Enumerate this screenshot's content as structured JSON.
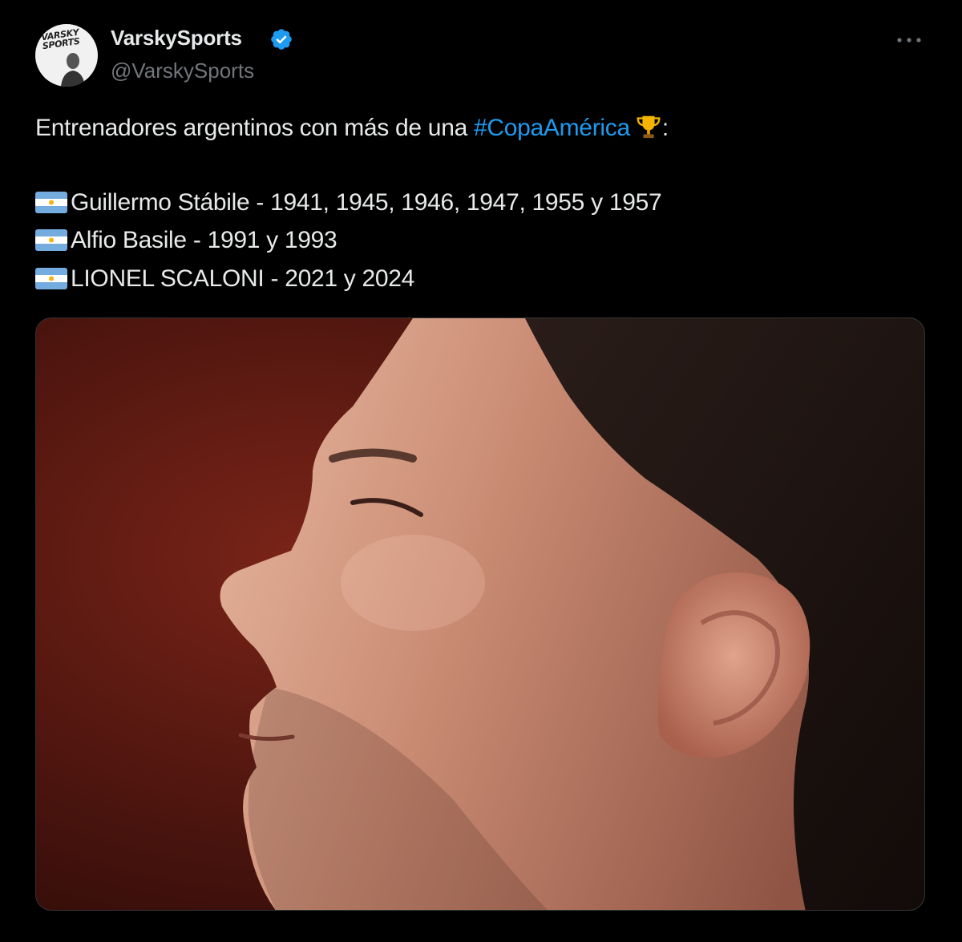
{
  "author": {
    "display_name": "VarskySports",
    "handle": "@VarskySports",
    "verified": true,
    "avatar_logo_text": "VARSKY SPORTS",
    "verified_color": "#1d9bf0"
  },
  "menu": {
    "more_icon": "more-horizontal-icon"
  },
  "tweet": {
    "intro_text": "Entrenadores argentinos con más de una ",
    "hashtag": "#CopaAmérica",
    "intro_suffix": ":",
    "trophy_icon": "trophy-icon",
    "flag_icon": "argentina-flag-icon",
    "lines": [
      "Guillermo Stábile - 1941, 1945, 1946, 1947, 1955 y 1957",
      "Alfio Basile - 1991 y 1993",
      "LIONEL SCALONI - 2021 y 2024"
    ],
    "hashtag_color": "#1d9bf0"
  },
  "media": {
    "type": "photo",
    "subject": "profile-portrait"
  }
}
